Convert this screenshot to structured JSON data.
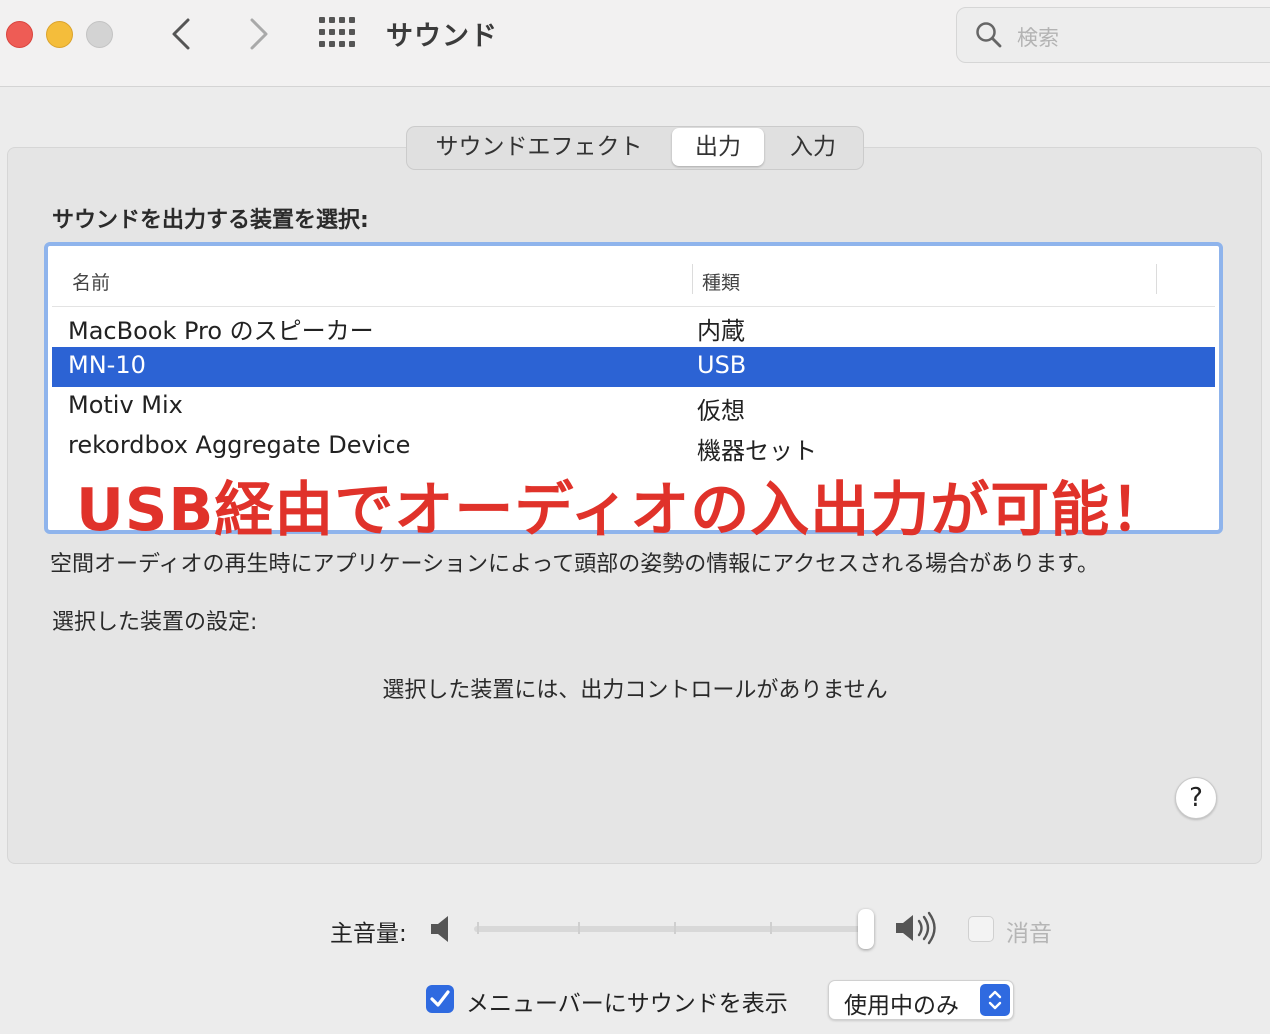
{
  "window": {
    "title": "サウンド"
  },
  "search": {
    "placeholder": "検索"
  },
  "tabs": [
    {
      "label": "サウンドエフェクト"
    },
    {
      "label": "出力"
    },
    {
      "label": "入力"
    }
  ],
  "output": {
    "heading": "サウンドを出力する装置を選択:",
    "columns": {
      "name": "名前",
      "type": "種類"
    },
    "devices": [
      {
        "name": "MacBook Pro のスピーカー",
        "type": "内蔵"
      },
      {
        "name": "MN-10",
        "type": "USB"
      },
      {
        "name": "Motiv Mix",
        "type": "仮想"
      },
      {
        "name": "rekordbox Aggregate Device",
        "type": "機器セット"
      }
    ],
    "selected_index": 1,
    "overlay_caption": "USB経由でオーディオの入出力が可能！",
    "spatial_note": "空間オーディオの再生時にアプリケーションによって頭部の姿勢の情報にアクセスされる場合があります。",
    "settings_label": "選択した装置の設定:",
    "no_controls_message": "選択した装置には、出力コントロールがありません",
    "help_label": "?"
  },
  "volume": {
    "label": "主音量:",
    "level": 1.0,
    "mute_label": "消音",
    "mute_checked": false
  },
  "menubar": {
    "checkbox_label": "メニューバーにサウンドを表示",
    "checked": true,
    "select_value": "使用中のみ"
  },
  "colors": {
    "selection": "#2c63d4",
    "accent": "#2f6ae0",
    "overlay_caption": "#e0322a"
  }
}
